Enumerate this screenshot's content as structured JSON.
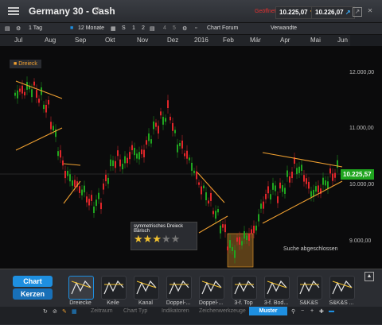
{
  "window": {
    "title": "Germany 30 - Cash",
    "status_text": "Geöffnet",
    "sell_price": "10.225,07",
    "buy_price": "10.226,07"
  },
  "toolbar": {
    "interval": "1 Tag",
    "range": "12 Monate",
    "s_label": "S",
    "b1": "1",
    "b2": "2",
    "b4": "4",
    "b5": "5",
    "forum": "Chart Forum",
    "tool": "Verwandte"
  },
  "months": [
    "Jul",
    "Aug",
    "Sep",
    "Okt",
    "Nov",
    "Dez",
    "2016",
    "Feb",
    "Mär",
    "Apr",
    "Mai",
    "Jun"
  ],
  "chart": {
    "pattern_tag": "Dreieck",
    "price_labels": [
      "12.000,00",
      "11.000,00",
      "10.000,00",
      "9.000,00"
    ],
    "current_price": "10.225,57",
    "tooltip_title": "symmetrisches Dreieck",
    "tooltip_sub": "Bärisch",
    "rating": 3,
    "rating_max": 5,
    "search_status": "Suche abgeschlossen"
  },
  "tabs": {
    "chart": "Chart",
    "kerzen": "Kerzen"
  },
  "patterns": [
    "Dreiecke",
    "Keile",
    "Kanal",
    "Doppel-...",
    "Doppel-...",
    "3-f. Top",
    "3-f. Bod...",
    "S&K&S",
    "S&K&S ..."
  ],
  "statusbar": {
    "zeitraum": "Zeitraum",
    "charttyp": "Chart Typ",
    "indikatoren": "Indikatoren",
    "zeichnen": "Zeichenwerkzeuge",
    "muster": "Muster"
  },
  "colors": {
    "up": "#1fa51f",
    "down": "#e0262a",
    "pattern": "#f0a030",
    "accent": "#1e8fe0"
  }
}
